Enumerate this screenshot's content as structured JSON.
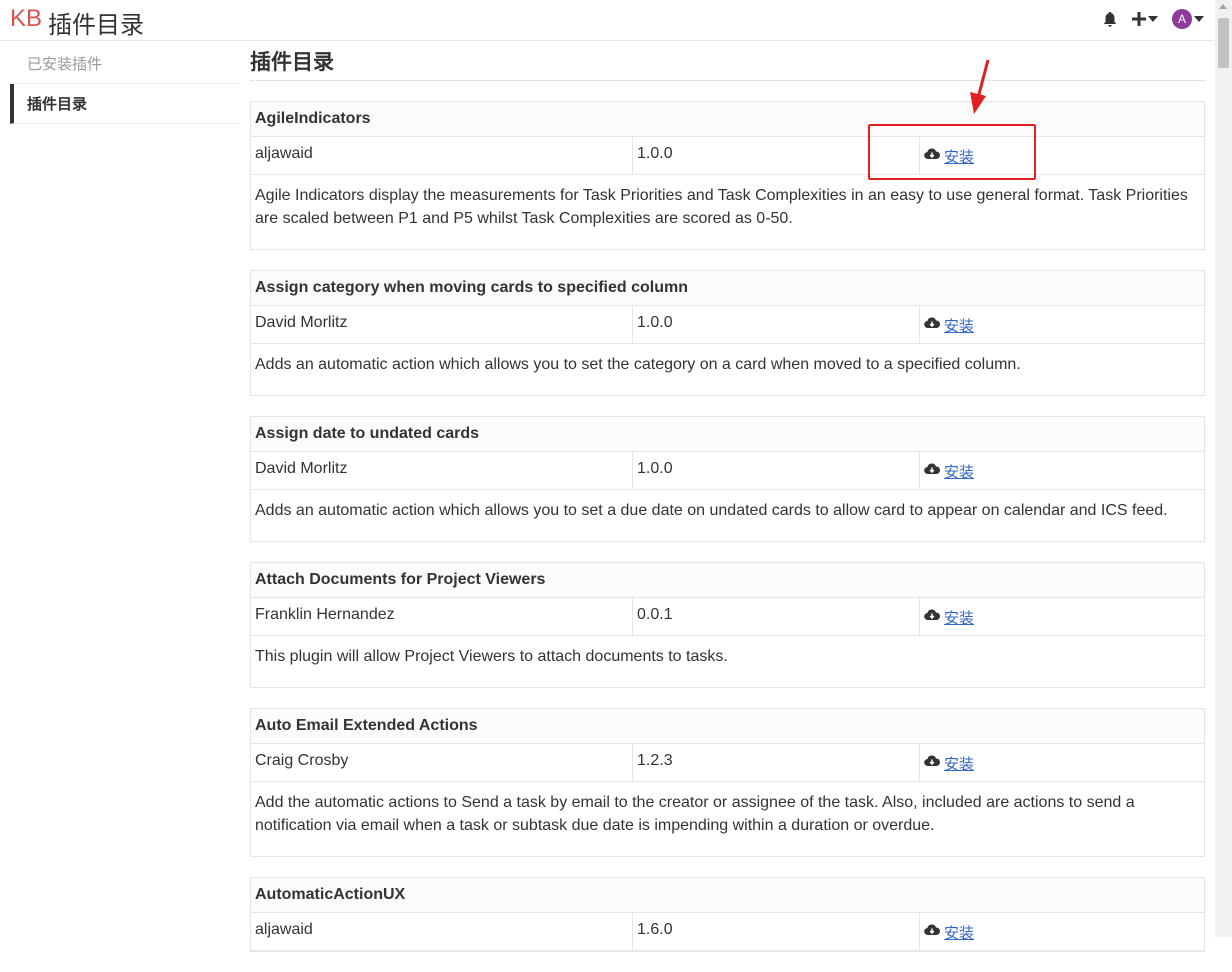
{
  "header": {
    "logo": "KB",
    "title": "插件目录"
  },
  "sidebar": {
    "items": [
      {
        "label": "已安装插件"
      },
      {
        "label": "插件目录"
      }
    ]
  },
  "main": {
    "title": "插件目录"
  },
  "install_label": "安装",
  "plugins": [
    {
      "name": "AgileIndicators",
      "author": "aljawaid",
      "version": "1.0.0",
      "description": "Agile Indicators display the measurements for Task Priorities and Task Complexities in an easy to use general format. Task Priorities are scaled between P1 and P5 whilst Task Complexities are scored as 0-50."
    },
    {
      "name": "Assign category when moving cards to specified column",
      "author": "David Morlitz",
      "version": "1.0.0",
      "description": "Adds an automatic action which allows you to set the category on a card when moved to a specified column."
    },
    {
      "name": "Assign date to undated cards",
      "author": "David Morlitz",
      "version": "1.0.0",
      "description": "Adds an automatic action which allows you to set a due date on undated cards to allow card to appear on calendar and ICS feed."
    },
    {
      "name": "Attach Documents for Project Viewers",
      "author": "Franklin Hernandez",
      "version": "0.0.1",
      "description": "This plugin will allow Project Viewers to attach documents to tasks."
    },
    {
      "name": "Auto Email Extended Actions",
      "author": "Craig Crosby",
      "version": "1.2.3",
      "description": "Add the automatic actions to Send a task by email to the creator or assignee of the task. Also, included are actions to send a notification via email when a task or subtask due date is impending within a duration or overdue."
    },
    {
      "name": "AutomaticActionUX",
      "author": "aljawaid",
      "version": "1.6.0",
      "description": ""
    }
  ],
  "avatar": {
    "initial": "A",
    "color": "#8e3a99"
  },
  "accent": {
    "link": "#3366cc",
    "highlight": "#e02020"
  }
}
